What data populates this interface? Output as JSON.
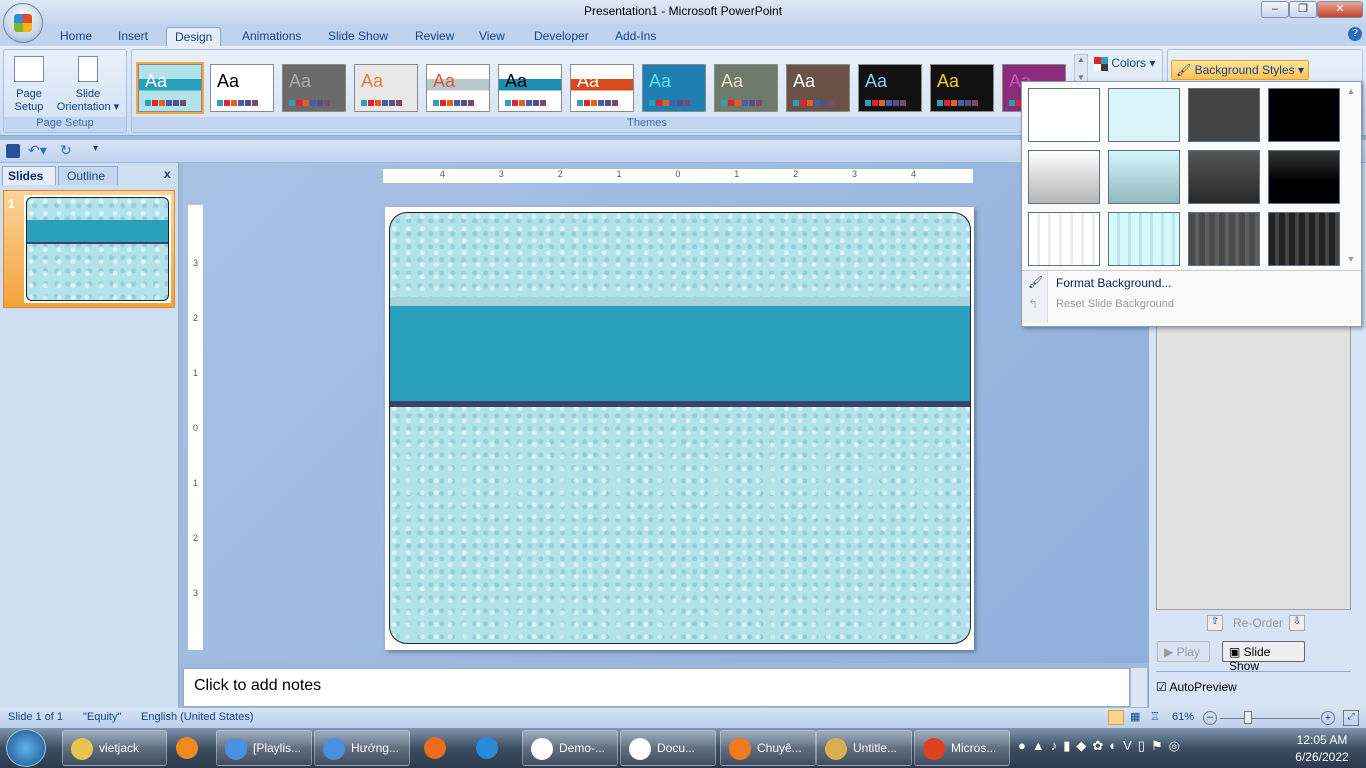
{
  "window": {
    "title": "Presentation1 - Microsoft PowerPoint"
  },
  "tabs": [
    {
      "label": "Home"
    },
    {
      "label": "Insert"
    },
    {
      "label": "Design",
      "active": true
    },
    {
      "label": "Animations"
    },
    {
      "label": "Slide Show"
    },
    {
      "label": "Review"
    },
    {
      "label": "View"
    },
    {
      "label": "Developer"
    },
    {
      "label": "Add-Ins"
    }
  ],
  "ribbon": {
    "page_setup": {
      "page_setup_label": "Page Setup",
      "orientation_label": "Slide Orientation",
      "group_label": "Page Setup"
    },
    "themes": {
      "group_label": "Themes",
      "theme_sample": "Aa"
    },
    "colors_label": "Colors",
    "background_styles_label": "Background Styles"
  },
  "left_pane": {
    "tabs": [
      {
        "label": "Slides",
        "active": true
      },
      {
        "label": "Outline"
      }
    ],
    "close": "x",
    "slide_number": "1"
  },
  "notes": {
    "placeholder": "Click to add notes"
  },
  "background_menu": {
    "styles": [
      {
        "id": "Style 1",
        "color": "#ffffff"
      },
      {
        "id": "Style 2",
        "color": "#dbf4f9"
      },
      {
        "id": "Style 3",
        "color": "#444444"
      },
      {
        "id": "Style 4",
        "color": "#000000"
      },
      {
        "id": "Style 5",
        "color": "gradient-light"
      },
      {
        "id": "Style 6",
        "color": "gradient-aqua"
      },
      {
        "id": "Style 7",
        "color": "gradient-dark"
      },
      {
        "id": "Style 8",
        "color": "gradient-black"
      },
      {
        "id": "Style 9",
        "color": "stripe-white"
      },
      {
        "id": "Style 10",
        "color": "stripe-aqua"
      },
      {
        "id": "Style 11",
        "color": "stripe-gray"
      },
      {
        "id": "Style 12",
        "color": "stripe-black"
      }
    ],
    "format_background": "Format Background...",
    "reset_background": "Reset Slide Background"
  },
  "right_pane": {
    "reorder": "Re-Order",
    "play": "Play",
    "slide_show": "Slide Show",
    "autopreview": "AutoPreview",
    "autopreview_checked": true
  },
  "status": {
    "slide": "Slide 1 of 1",
    "theme": "\"Equity\"",
    "language": "English (United States)",
    "zoom": "61%"
  },
  "taskbar": {
    "items": [
      {
        "label": "vietjack"
      },
      {
        "label": ""
      },
      {
        "label": "[Playlis..."
      },
      {
        "label": "Hướng..."
      },
      {
        "label": ""
      },
      {
        "label": ""
      },
      {
        "label": "Demo-..."
      },
      {
        "label": "Docu..."
      },
      {
        "label": "Chuyê..."
      },
      {
        "label": "Untitle..."
      },
      {
        "label": "Micros..."
      }
    ],
    "time": "12:05 AM",
    "date": "6/26/2022"
  },
  "ruler": {
    "h_labels": [
      "4",
      "3",
      "2",
      "1",
      "0",
      "1",
      "2",
      "3",
      "4"
    ],
    "v_labels": [
      "3",
      "2",
      "1",
      "0",
      "1",
      "2",
      "3"
    ]
  },
  "colors": {
    "accent": "#2ba0bd",
    "band_dark": "#3f3f6b",
    "selection": "#f5a640"
  }
}
